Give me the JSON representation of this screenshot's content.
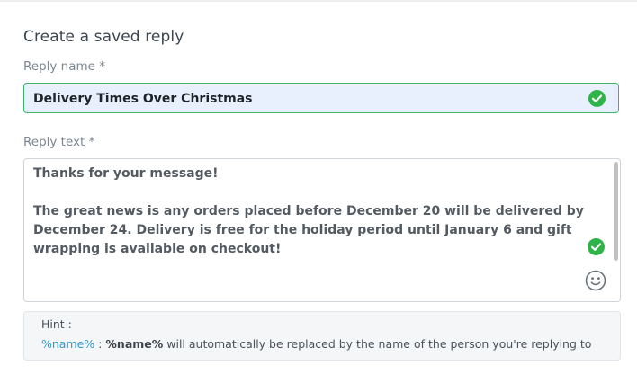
{
  "form": {
    "title": "Create a saved reply",
    "reply_name": {
      "label": "Reply name *",
      "value": "Delivery Times Over Christmas",
      "valid_icon": "check-circle-icon"
    },
    "reply_text": {
      "label": "Reply text *",
      "paragraphs": [
        "Thanks for your message!",
        "The great news is any orders placed before December 20 will be delivered by December 24.  Delivery is free for the holiday period until January 6 and gift wrapping is available on checkout!"
      ],
      "valid_icon": "check-circle-icon",
      "emoji_icon": "smiley-icon"
    },
    "hint": {
      "title": "Hint :",
      "token": "%name%",
      "separator": " : ",
      "token_bold": "%name%",
      "description": " will automatically be replaced by the name of the person you're replying to"
    }
  },
  "colors": {
    "accent_green": "#2fb44a",
    "input_border_valid": "#3cb46a",
    "input_bg_filled": "#e9f0fd",
    "token_blue": "#2a9bd6"
  }
}
